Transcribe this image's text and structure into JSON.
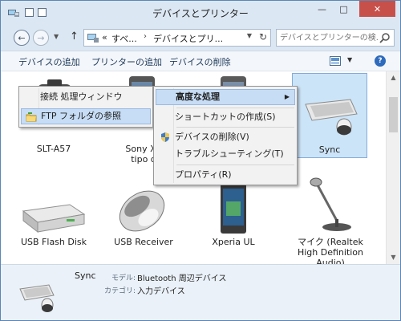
{
  "window": {
    "title": "デバイスとプリンター",
    "minimize_glyph": "—",
    "maximize_glyph": "□",
    "close_glyph": "✕"
  },
  "address": {
    "back_glyph": "←",
    "forward_glyph": "→",
    "up_glyph": "↑",
    "overflow": "«",
    "crumb1": "すべ...",
    "crumb2": "デバイスとプリ...",
    "sep": "›",
    "search_placeholder": "デバイスとプリンターの検..."
  },
  "toolbar": {
    "add_device": "デバイスの追加",
    "add_printer": "プリンターの追加",
    "remove_device": "デバイスの削除",
    "help_glyph": "?"
  },
  "devices": {
    "row1": [
      {
        "label": "SLT-A57"
      },
      {
        "label": "Sony Xp",
        "label2": "tipo d"
      },
      {
        "label": ""
      },
      {
        "label": "Sync"
      }
    ],
    "row2": [
      {
        "label": "USB Flash Disk"
      },
      {
        "label": "USB Receiver"
      },
      {
        "label": "Xperia UL"
      },
      {
        "label": "マイク (Realtek",
        "label2": "High Definition",
        "label3": "Audio)"
      }
    ]
  },
  "menu_left": {
    "items": [
      {
        "label": "接続 処理ウィンドウ",
        "icon": "none",
        "highlighted": false
      },
      {
        "label": "FTP フォルダの参照",
        "icon": "folder-icon",
        "highlighted": true
      }
    ]
  },
  "menu_right": {
    "items": [
      {
        "label": "高度な処理",
        "bold": true,
        "highlighted": true,
        "submenu": true
      },
      {
        "label": "ショートカットの作成(S)"
      },
      {
        "label": "デバイスの削除(V)",
        "icon": "shield-icon"
      },
      {
        "label": "トラブルシューティング(T)"
      },
      {
        "label": "プロパティ(R)"
      }
    ],
    "submenu_glyph": "▶"
  },
  "details": {
    "name": "Sync",
    "model_label": "モデル:",
    "model_value": "Bluetooth 周辺デバイス",
    "category_label": "カテゴリ:",
    "category_value": "入力デバイス"
  },
  "colors": {
    "selection": "#cce4f7",
    "menu_highlight": "#c7ddf5",
    "close_button": "#c7504a",
    "details_bg": "#eaf1f8"
  }
}
